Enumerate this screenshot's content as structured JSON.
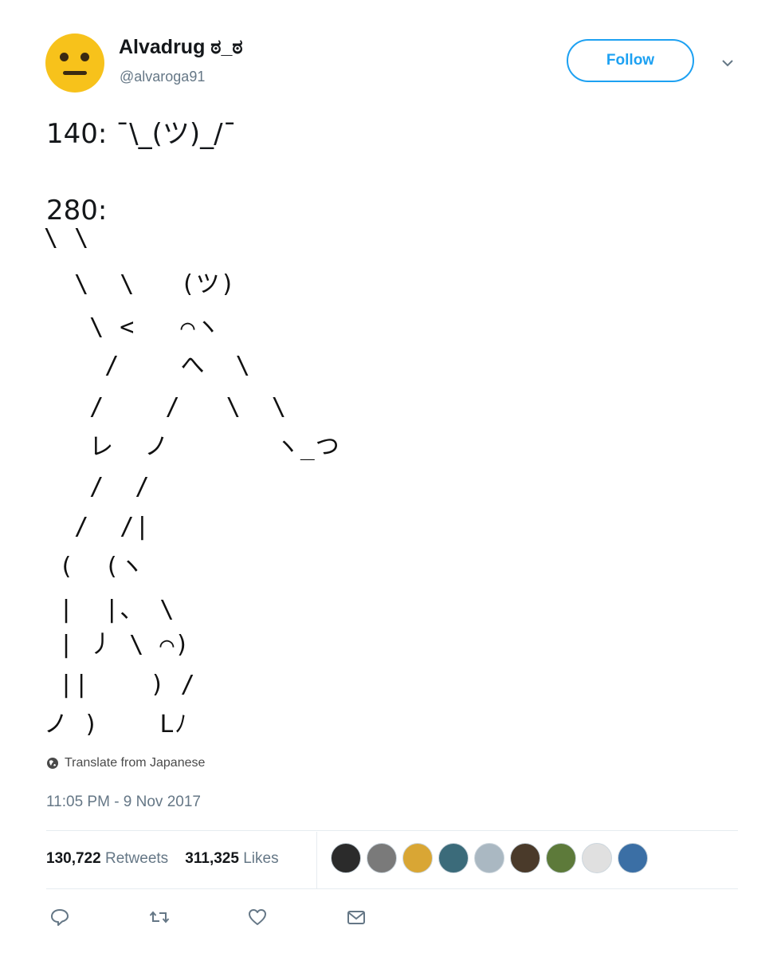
{
  "user": {
    "name": "Alvadrug ಠ_ಠ",
    "handle": "@alvaroga91",
    "avatar_icon": "neutral-face-icon"
  },
  "follow_label": "Follow",
  "tweet": {
    "line1": "140: ¯\\_(ツ)_/¯",
    "line2": "280:",
    "ascii_art": [
      "\\ \\",
      "  \\  \\   (ツ)",
      "   \\ <   ⌒ヽ",
      "    /    へ  \\",
      "   /    /   \\  \\",
      "   レ  ノ       ヽ_つ",
      "   /  /",
      "  /  /|",
      " (  (ヽ",
      " |  |、 \\",
      " | 丿 \\ ⌒)",
      " ||    ) /",
      "ノ )    Lﾉ"
    ]
  },
  "translate_label": "Translate from Japanese",
  "timestamp": "11:05 PM - 9 Nov 2017",
  "stats": {
    "retweets_count": "130,722",
    "retweets_label": "Retweets",
    "likes_count": "311,325",
    "likes_label": "Likes"
  },
  "liker_avatar_colors": [
    "#2b2b2b",
    "#7a7a7a",
    "#d9a634",
    "#3b6b7a",
    "#aab8c2",
    "#4a3a2a",
    "#5d7a3a",
    "#e0e0e0",
    "#3b6fa5"
  ],
  "colors": {
    "accent": "#1da1f2",
    "muted": "#657786"
  }
}
